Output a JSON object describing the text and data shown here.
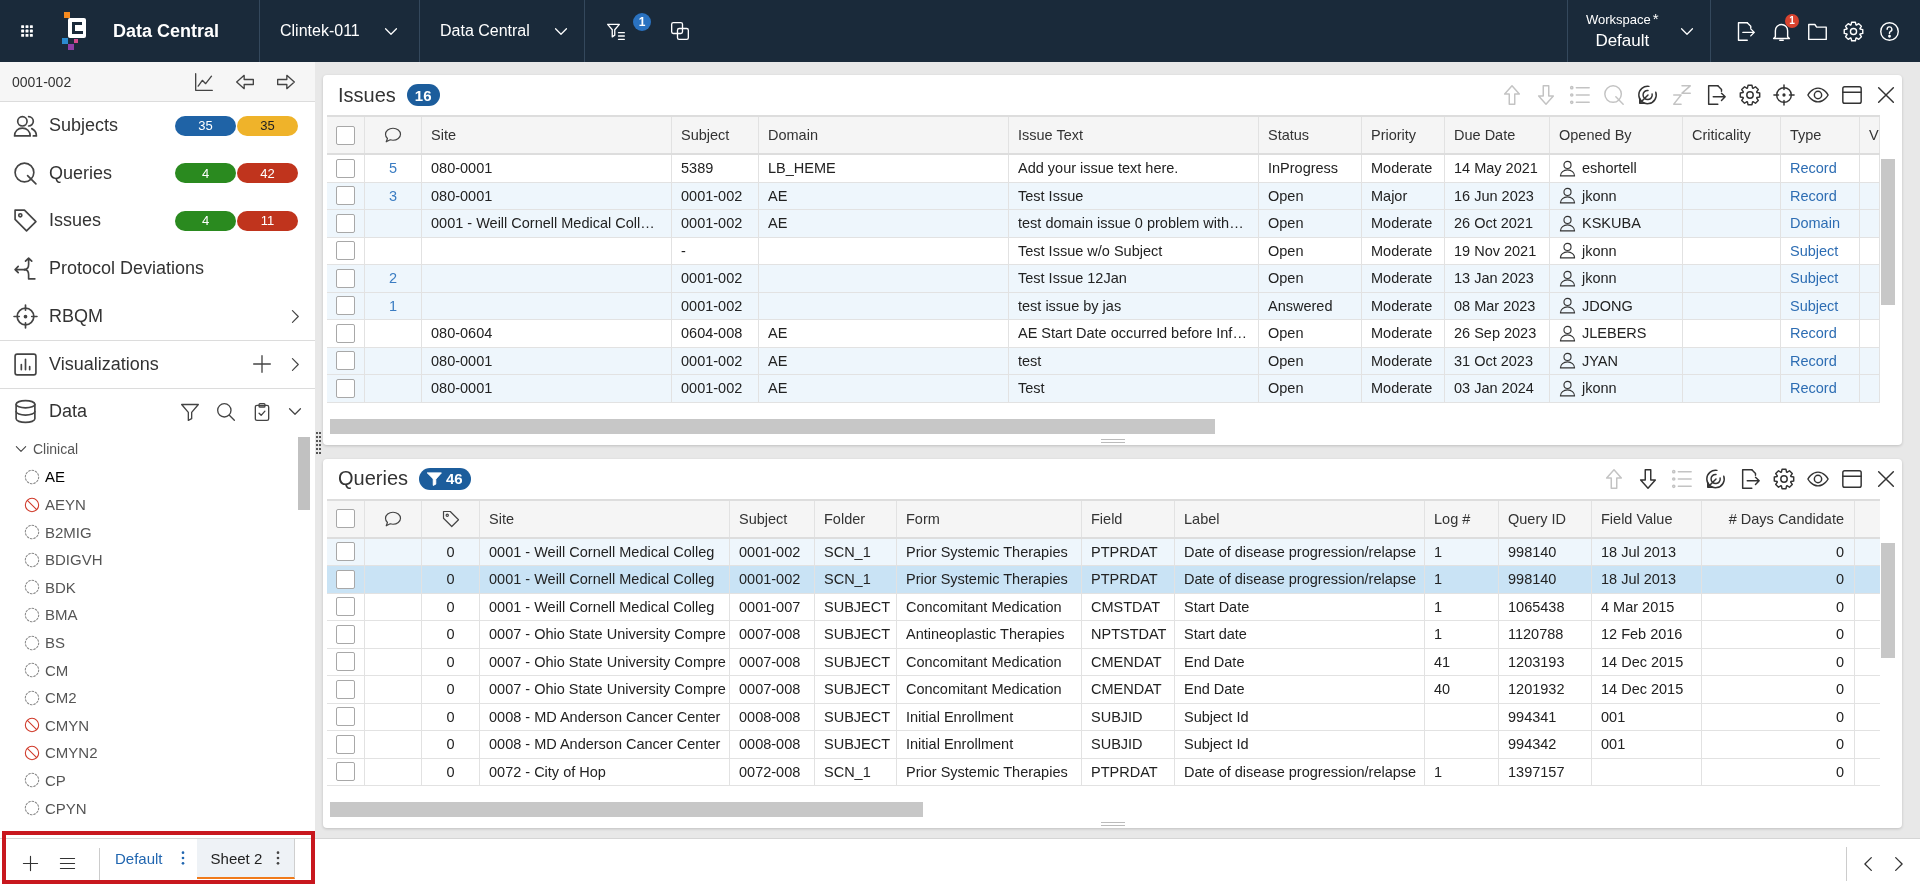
{
  "top_bar": {
    "app_name": "Data Central",
    "study": "Clintek-011",
    "module": "Data Central",
    "filter_count": "1",
    "workspace": {
      "label": "Workspace",
      "marker": "*",
      "name": "Default"
    },
    "notification_count": "1"
  },
  "sidebar": {
    "subject": "0001-002",
    "nav": [
      {
        "kind": "subjects",
        "label": "Subjects",
        "counts": [
          {
            "value": "35",
            "color": "#1f63a6"
          },
          {
            "value": "35",
            "color": "#efb32a"
          }
        ]
      },
      {
        "kind": "queries",
        "label": "Queries",
        "counts": [
          {
            "value": "4",
            "color": "#2a8a1f"
          },
          {
            "value": "42",
            "color": "#c0341d"
          }
        ]
      },
      {
        "kind": "issues",
        "label": "Issues",
        "counts": [
          {
            "value": "4",
            "color": "#2a8a1f"
          },
          {
            "value": "11",
            "color": "#c0341d"
          }
        ]
      },
      {
        "kind": "deviations",
        "label": "Protocol Deviations"
      },
      {
        "kind": "rbqm",
        "label": "RBQM",
        "expanded": false
      },
      {
        "kind": "visualizations",
        "label": "Visualizations",
        "expanded": false
      },
      {
        "kind": "data",
        "label": "Data",
        "expanded": true
      }
    ],
    "tree": [
      {
        "label": "Clinical",
        "expanded": true,
        "children": [
          {
            "label": "AE",
            "kind": "dataset",
            "selected": true
          },
          {
            "label": "AEYN",
            "kind": "blocked",
            "selected": false
          },
          {
            "label": "B2MIG",
            "kind": "dataset",
            "selected": false
          },
          {
            "label": "BDIGVH",
            "kind": "dataset",
            "selected": false
          },
          {
            "label": "BDK",
            "kind": "dataset",
            "selected": false
          },
          {
            "label": "BMA",
            "kind": "dataset",
            "selected": false
          },
          {
            "label": "BS",
            "kind": "dataset",
            "selected": false
          },
          {
            "label": "CM",
            "kind": "dataset",
            "selected": false
          },
          {
            "label": "CM2",
            "kind": "dataset",
            "selected": false
          },
          {
            "label": "CMYN",
            "kind": "blocked",
            "selected": false
          },
          {
            "label": "CMYN2",
            "kind": "blocked",
            "selected": false
          },
          {
            "label": "CP",
            "kind": "dataset",
            "selected": false
          },
          {
            "label": "CPYN",
            "kind": "dataset",
            "selected": false
          }
        ]
      }
    ]
  },
  "issues_panel": {
    "title": "Issues",
    "count_badge": {
      "count": "16",
      "filtered": false
    },
    "toolbar": [
      {
        "kind": "up",
        "disabled": true
      },
      {
        "kind": "down",
        "disabled": true
      },
      {
        "kind": "list",
        "disabled": true
      },
      {
        "kind": "find",
        "disabled": true
      },
      {
        "kind": "track",
        "disabled": false
      },
      {
        "kind": "snooze",
        "disabled": true
      },
      {
        "kind": "export",
        "disabled": false
      },
      {
        "kind": "settings",
        "disabled": false
      },
      {
        "kind": "locate",
        "disabled": false
      },
      {
        "kind": "view",
        "disabled": false
      },
      {
        "kind": "layout",
        "disabled": false
      },
      {
        "kind": "close",
        "disabled": false
      }
    ],
    "all_checked": false,
    "columns": [
      {
        "kind": "comments"
      },
      {
        "kind": "text",
        "label": "Site"
      },
      {
        "kind": "text",
        "label": "Subject"
      },
      {
        "kind": "text",
        "label": "Domain"
      },
      {
        "kind": "text",
        "label": "Issue Text"
      },
      {
        "kind": "text",
        "label": "Status"
      },
      {
        "kind": "text",
        "label": "Priority"
      },
      {
        "kind": "text",
        "label": "Due Date"
      },
      {
        "kind": "user",
        "label": "Opened By"
      },
      {
        "kind": "text",
        "label": "Criticality"
      },
      {
        "kind": "link",
        "label": "Type"
      },
      {
        "kind": "text",
        "label": "V"
      }
    ],
    "rows": [
      {
        "checked": false,
        "highlighted": false,
        "selected": false,
        "cells": [
          "5",
          "080-0001",
          "5389",
          "LB_HEME",
          "Add your issue text here.",
          "InProgress",
          "Moderate",
          "14 May 2021",
          "eshortell",
          null,
          "Record",
          null
        ]
      },
      {
        "checked": false,
        "highlighted": true,
        "selected": false,
        "cells": [
          "3",
          "080-0001",
          "0001-002",
          "AE",
          "Test Issue",
          "Open",
          "Major",
          "16 Jun 2023",
          "jkonn",
          null,
          "Record",
          null
        ]
      },
      {
        "checked": false,
        "highlighted": true,
        "selected": false,
        "cells": [
          null,
          "0001 - Weill Cornell Medical Coll…",
          "0001-002",
          "AE",
          "test domain issue 0 problem with…",
          "Open",
          "Moderate",
          "26 Oct 2021",
          "KSKUBA",
          null,
          "Domain",
          null
        ]
      },
      {
        "checked": false,
        "highlighted": false,
        "selected": false,
        "cells": [
          null,
          null,
          "-",
          null,
          "Test Issue w/o Subject",
          "Open",
          "Moderate",
          "19 Nov 2021",
          "jkonn",
          null,
          "Subject",
          null
        ]
      },
      {
        "checked": false,
        "highlighted": true,
        "selected": false,
        "cells": [
          "2",
          null,
          "0001-002",
          null,
          "Test Issue 12Jan",
          "Open",
          "Moderate",
          "13 Jan 2023",
          "jkonn",
          null,
          "Subject",
          null
        ]
      },
      {
        "checked": false,
        "highlighted": true,
        "selected": false,
        "cells": [
          "1",
          null,
          "0001-002",
          null,
          "test issue by jas",
          "Answered",
          "Moderate",
          "08 Mar 2023",
          "JDONG",
          null,
          "Subject",
          null
        ]
      },
      {
        "checked": false,
        "highlighted": false,
        "selected": false,
        "cells": [
          null,
          "080-0604",
          "0604-008",
          "AE",
          "AE Start Date occurred before Inf…",
          "Open",
          "Moderate",
          "26 Sep 2023",
          "JLEBERS",
          null,
          "Record",
          null
        ]
      },
      {
        "checked": false,
        "highlighted": true,
        "selected": false,
        "cells": [
          null,
          "080-0001",
          "0001-002",
          "AE",
          "test",
          "Open",
          "Moderate",
          "31 Oct 2023",
          "JYAN",
          null,
          "Record",
          null
        ]
      },
      {
        "checked": false,
        "highlighted": true,
        "selected": false,
        "cells": [
          null,
          "080-0001",
          "0001-002",
          "AE",
          "Test",
          "Open",
          "Moderate",
          "03 Jan 2024",
          "jkonn",
          null,
          "Record",
          null
        ]
      }
    ]
  },
  "queries_panel": {
    "title": "Queries",
    "count_badge": {
      "count": "46",
      "filtered": true
    },
    "toolbar": [
      {
        "kind": "up",
        "disabled": true
      },
      {
        "kind": "down",
        "disabled": false
      },
      {
        "kind": "list",
        "disabled": true
      },
      {
        "kind": "track",
        "disabled": false
      },
      {
        "kind": "export",
        "disabled": false
      },
      {
        "kind": "settings",
        "disabled": false
      },
      {
        "kind": "view",
        "disabled": false
      },
      {
        "kind": "layout",
        "disabled": false
      },
      {
        "kind": "close",
        "disabled": false
      }
    ],
    "all_checked": false,
    "columns": [
      {
        "kind": "comments"
      },
      {
        "kind": "tags"
      },
      {
        "kind": "text",
        "label": "Site"
      },
      {
        "kind": "text",
        "label": "Subject"
      },
      {
        "kind": "text",
        "label": "Folder"
      },
      {
        "kind": "text",
        "label": "Form"
      },
      {
        "kind": "text",
        "label": "Field"
      },
      {
        "kind": "text",
        "label": "Label"
      },
      {
        "kind": "text",
        "label": "Log #"
      },
      {
        "kind": "text",
        "label": "Query ID"
      },
      {
        "kind": "text",
        "label": "Field Value"
      },
      {
        "kind": "number",
        "label": "# Days Candidate"
      }
    ],
    "rows": [
      {
        "checked": false,
        "highlighted": true,
        "selected": false,
        "cells": [
          null,
          "0",
          "0001 - Weill Cornell Medical Colleg",
          "0001-002",
          "SCN_1",
          "Prior Systemic Therapies",
          "PTPRDAT",
          "Date of disease progression/relapse",
          "1",
          "998140",
          "18 Jul 2013",
          "0"
        ]
      },
      {
        "checked": false,
        "highlighted": true,
        "selected": true,
        "cells": [
          null,
          "0",
          "0001 - Weill Cornell Medical Colleg",
          "0001-002",
          "SCN_1",
          "Prior Systemic Therapies",
          "PTPRDAT",
          "Date of disease progression/relapse",
          "1",
          "998140",
          "18 Jul 2013",
          "0"
        ]
      },
      {
        "checked": false,
        "highlighted": false,
        "selected": false,
        "cells": [
          null,
          "0",
          "0001 - Weill Cornell Medical Colleg",
          "0001-007",
          "SUBJECT",
          "Concomitant Medication",
          "CMSTDAT",
          "Start Date",
          "1",
          "1065438",
          "4 Mar 2015",
          "0"
        ]
      },
      {
        "checked": false,
        "highlighted": false,
        "selected": false,
        "cells": [
          null,
          "0",
          "0007 - Ohio State University Compre",
          "0007-008",
          "SUBJECT",
          "Antineoplastic Therapies",
          "NPTSTDAT",
          "Start date",
          "1",
          "1120788",
          "12 Feb 2016",
          "0"
        ]
      },
      {
        "checked": false,
        "highlighted": false,
        "selected": false,
        "cells": [
          null,
          "0",
          "0007 - Ohio State University Compre",
          "0007-008",
          "SUBJECT",
          "Concomitant Medication",
          "CMENDAT",
          "End Date",
          "41",
          "1203193",
          "14 Dec 2015",
          "0"
        ]
      },
      {
        "checked": false,
        "highlighted": false,
        "selected": false,
        "cells": [
          null,
          "0",
          "0007 - Ohio State University Compre",
          "0007-008",
          "SUBJECT",
          "Concomitant Medication",
          "CMENDAT",
          "End Date",
          "40",
          "1201932",
          "14 Dec 2015",
          "0"
        ]
      },
      {
        "checked": false,
        "highlighted": false,
        "selected": false,
        "cells": [
          null,
          "0",
          "0008 - MD Anderson Cancer Center",
          "0008-008",
          "SUBJECT",
          "Initial Enrollment",
          "SUBJID",
          "Subject Id",
          null,
          "994341",
          "001",
          "0"
        ]
      },
      {
        "checked": false,
        "highlighted": false,
        "selected": false,
        "cells": [
          null,
          "0",
          "0008 - MD Anderson Cancer Center",
          "0008-008",
          "SUBJECT",
          "Initial Enrollment",
          "SUBJID",
          "Subject Id",
          null,
          "994342",
          "001",
          "0"
        ]
      },
      {
        "checked": false,
        "highlighted": false,
        "selected": false,
        "cells": [
          null,
          "0",
          "0072 - City of Hop",
          "0072-008",
          "SCN_1",
          "Prior Systemic Therapies",
          "PTPRDAT",
          "Date of disease progression/relapse",
          "1",
          "1397157",
          null,
          "0"
        ]
      }
    ]
  },
  "sheet_bar": {
    "tabs": [
      {
        "label": "Default",
        "selected": false
      },
      {
        "label": "Sheet 2",
        "selected": true
      }
    ]
  }
}
